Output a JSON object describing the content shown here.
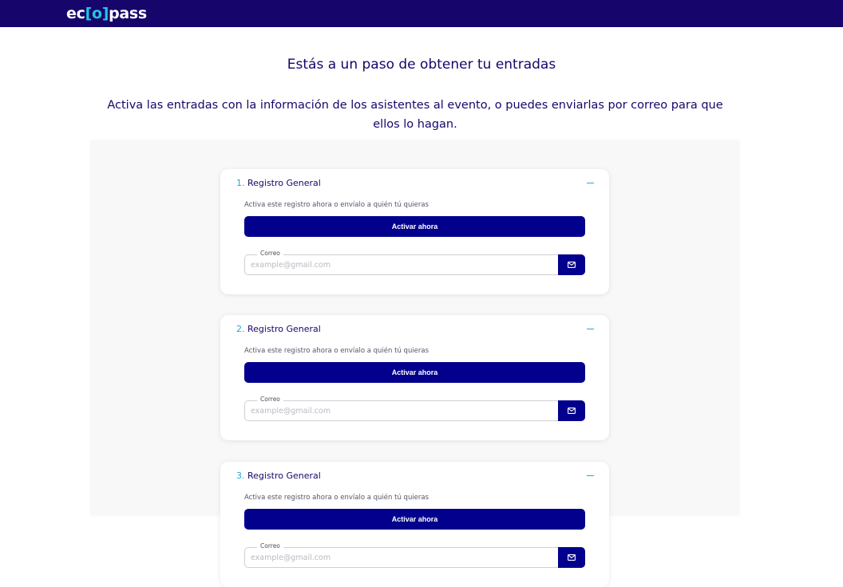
{
  "header": {
    "logo_text": "ec[o]pass",
    "logo_prefix": "ec",
    "logo_mark": "[o]",
    "logo_suffix": "pass"
  },
  "main": {
    "heading": "Estás a un paso de obtener tu entradas",
    "subheading": "Activa las entradas con la información de los asistentes al evento, o puedes enviarlas por correo para que ellos lo hagan."
  },
  "cards": [
    {
      "number": "1.",
      "title": "Registro General",
      "description": "Activa este registro ahora o envíalo a quién tú quieras",
      "activate_label": "Activar ahora",
      "email_label": "Correo",
      "email_placeholder": "example@gmail.com",
      "email_value": ""
    },
    {
      "number": "2.",
      "title": "Registro General",
      "description": "Activa este registro ahora o envíalo a quién tú quieras",
      "activate_label": "Activar ahora",
      "email_label": "Correo",
      "email_placeholder": "example@gmail.com",
      "email_value": ""
    },
    {
      "number": "3.",
      "title": "Registro General",
      "description": "Activa este registro ahora o envíalo a quién tú quieras",
      "activate_label": "Activar ahora",
      "email_label": "Correo",
      "email_placeholder": "example@gmail.com",
      "email_value": ""
    }
  ],
  "icons": {
    "collapse": "minus-icon",
    "send": "mail-icon"
  },
  "colors": {
    "brand_navy": "#16066b",
    "button_blue": "#02008c",
    "accent_cyan": "#21a9d8"
  }
}
